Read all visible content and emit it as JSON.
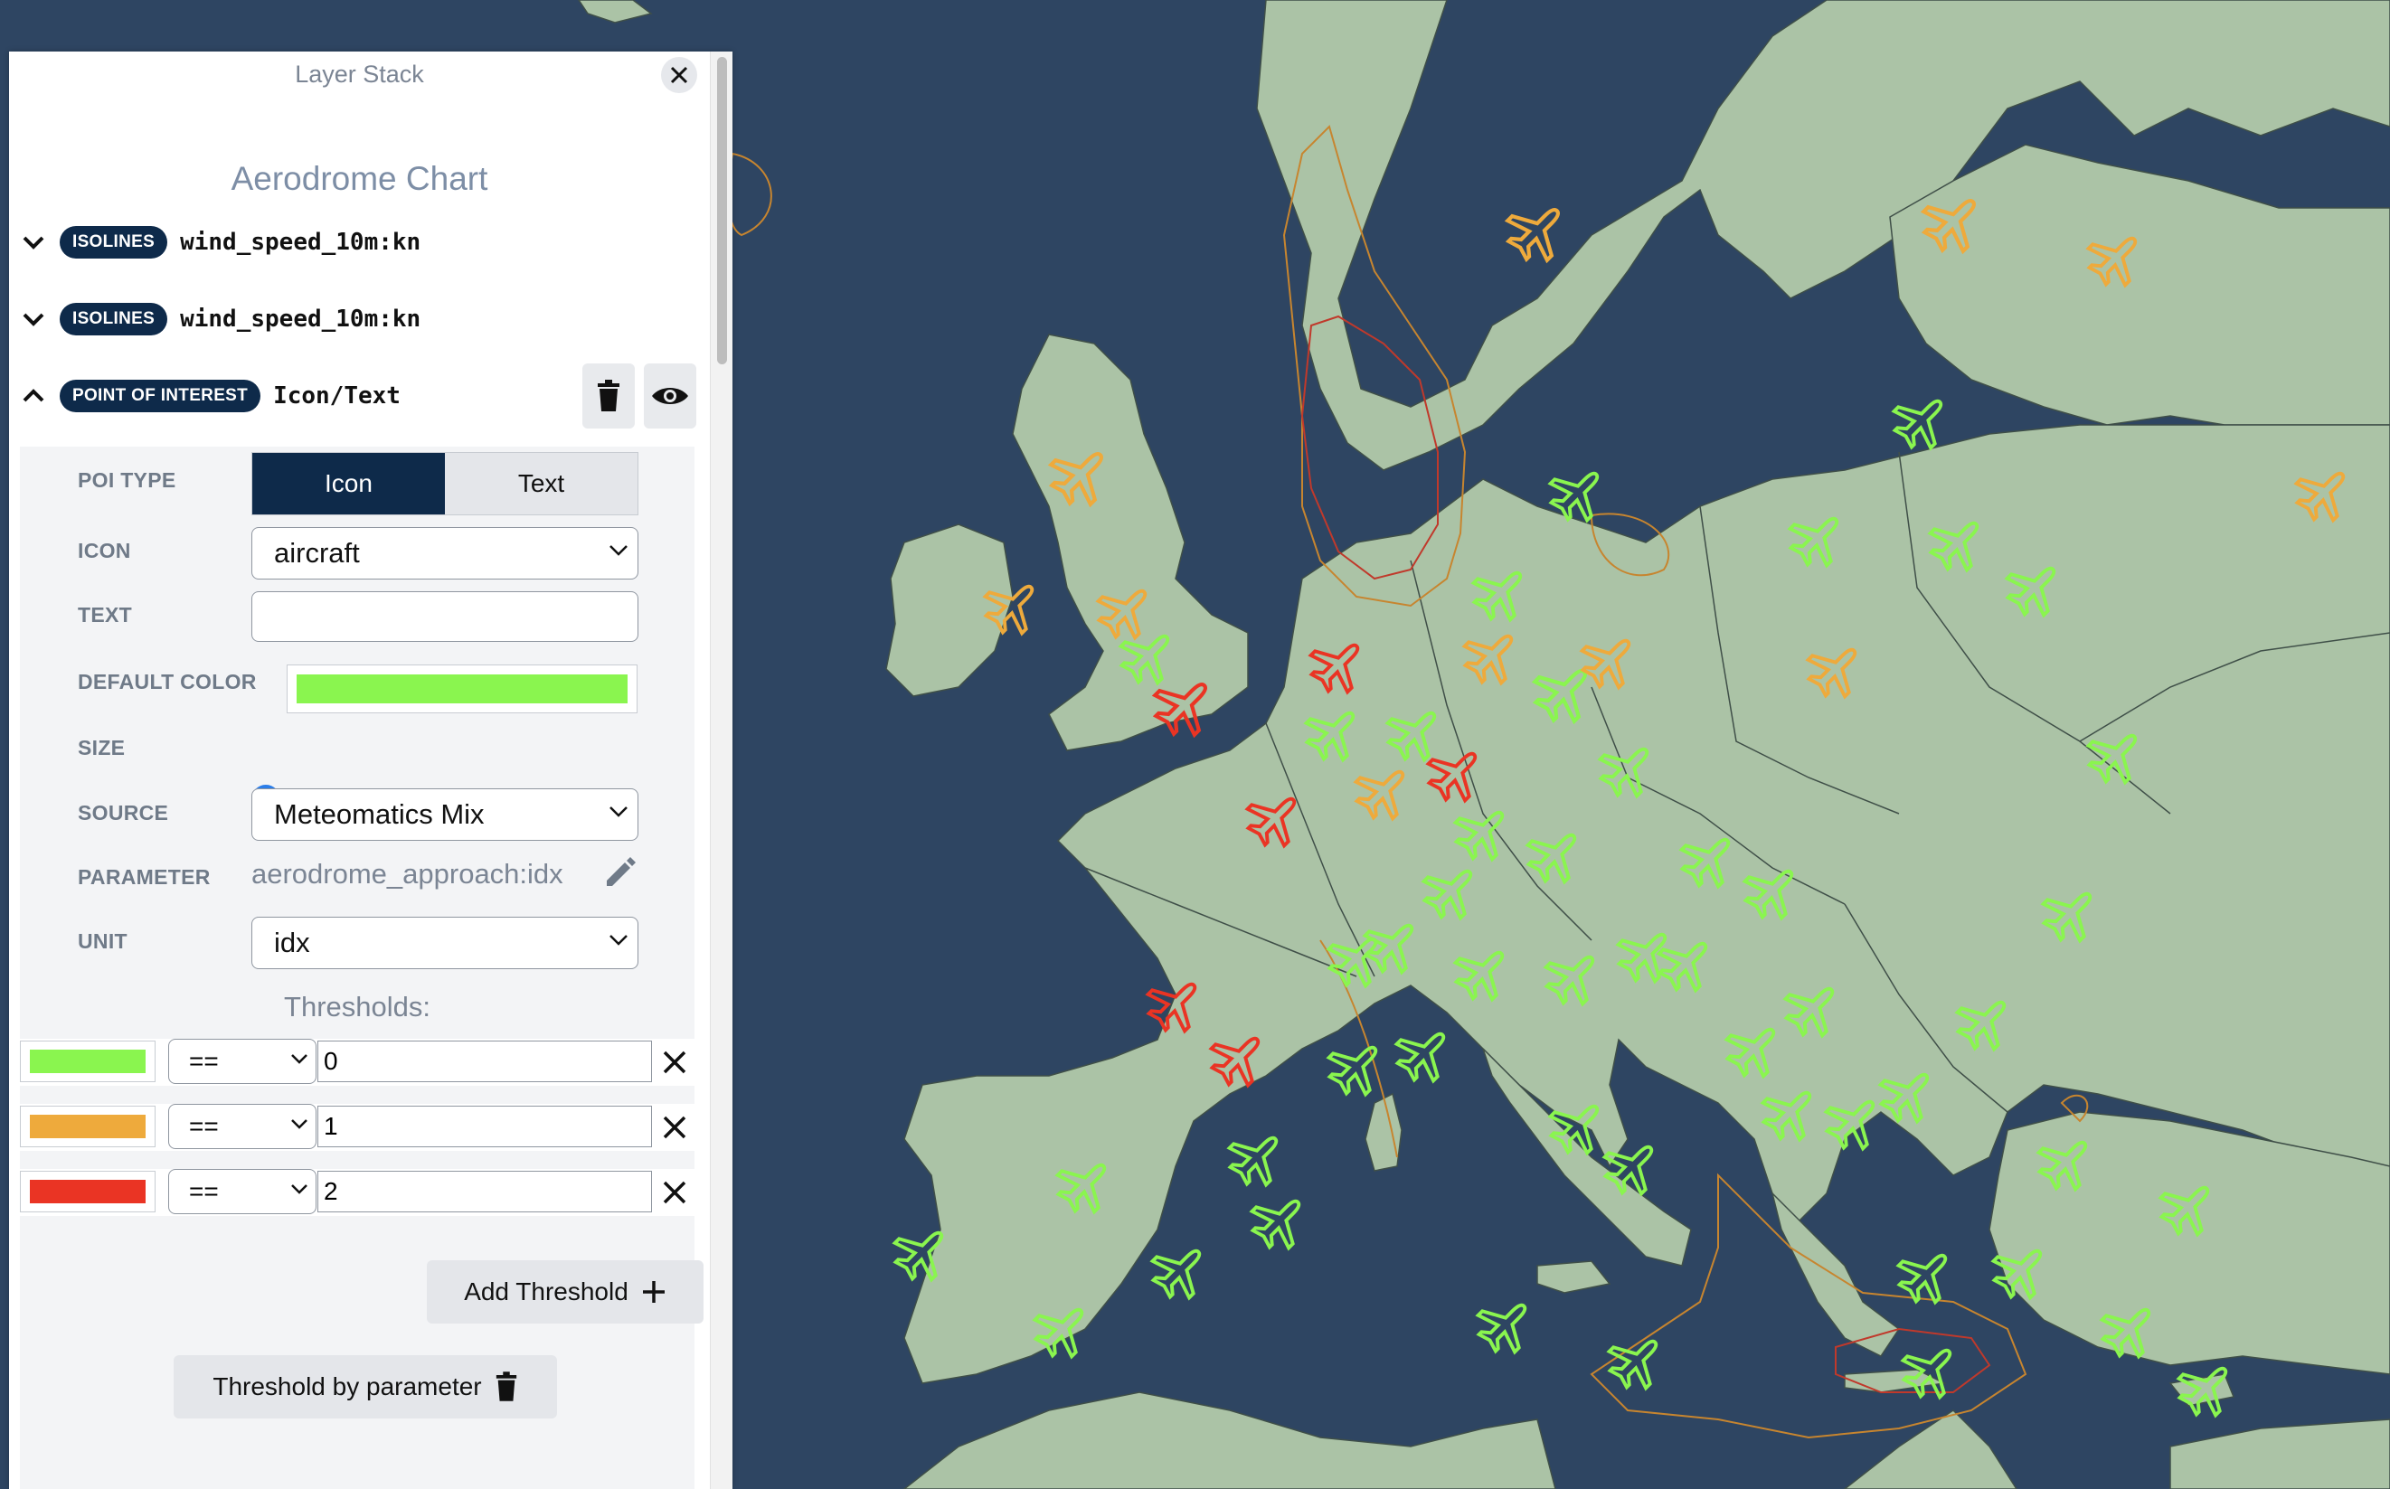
{
  "panel": {
    "title": "Layer Stack",
    "chart_title": "Aerodrome Chart",
    "layers": [
      {
        "type": "ISOLINES",
        "name": "wind_speed_10m:kn"
      },
      {
        "type": "ISOLINES",
        "name": "wind_speed_10m:kn"
      },
      {
        "type": "POINT OF INTEREST",
        "name": "Icon/Text"
      }
    ]
  },
  "settings": {
    "poi_type_label": "POI TYPE",
    "poi_options": [
      "Icon",
      "Text"
    ],
    "icon_label": "ICON",
    "icon_value": "aircraft",
    "text_label": "TEXT",
    "text_value": "",
    "default_color_label": "DEFAULT COLOR",
    "default_color": "#8af54f",
    "size_label": "SIZE",
    "size_value": 0,
    "source_label": "SOURCE",
    "source_value": "Meteomatics Mix",
    "parameter_label": "PARAMETER",
    "parameter_value": "aerodrome_approach:idx",
    "unit_label": "UNIT",
    "unit_value": "idx",
    "thresholds_title": "Thresholds:",
    "thresholds": [
      {
        "color": "#8af54f",
        "op": "==",
        "value": "0"
      },
      {
        "color": "#eeaa3c",
        "op": "==",
        "value": "1"
      },
      {
        "color": "#ea3424",
        "op": "==",
        "value": "2"
      }
    ],
    "add_threshold_label": "Add Threshold",
    "threshold_by_parameter_label": "Threshold by parameter"
  },
  "map": {
    "sea_color": "#2e4562",
    "land_color": "#abc3a6",
    "icon_name": "aircraft-icon"
  }
}
